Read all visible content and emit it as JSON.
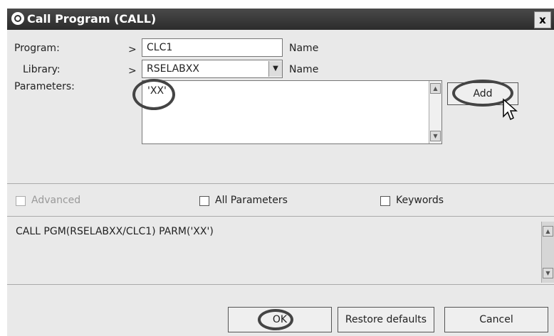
{
  "window": {
    "title": "Call Program (CALL)",
    "close_label": "x"
  },
  "form": {
    "program": {
      "label": "Program:",
      "prompt": ">",
      "value": "CLC1",
      "kind": "Name"
    },
    "library": {
      "label": "Library:",
      "prompt": ">",
      "value": "RSELABXX",
      "kind": "Name"
    },
    "parameters": {
      "label": "Parameters:",
      "items": [
        "'XX'"
      ]
    },
    "add_button": "Add"
  },
  "options": {
    "advanced": "Advanced",
    "all_parameters": "All Parameters",
    "keywords": "Keywords"
  },
  "command": {
    "text": "CALL PGM(RSELABXX/CLC1) PARM('XX')"
  },
  "buttons": {
    "ok": "OK",
    "restore_defaults": "Restore defaults",
    "cancel": "Cancel"
  }
}
